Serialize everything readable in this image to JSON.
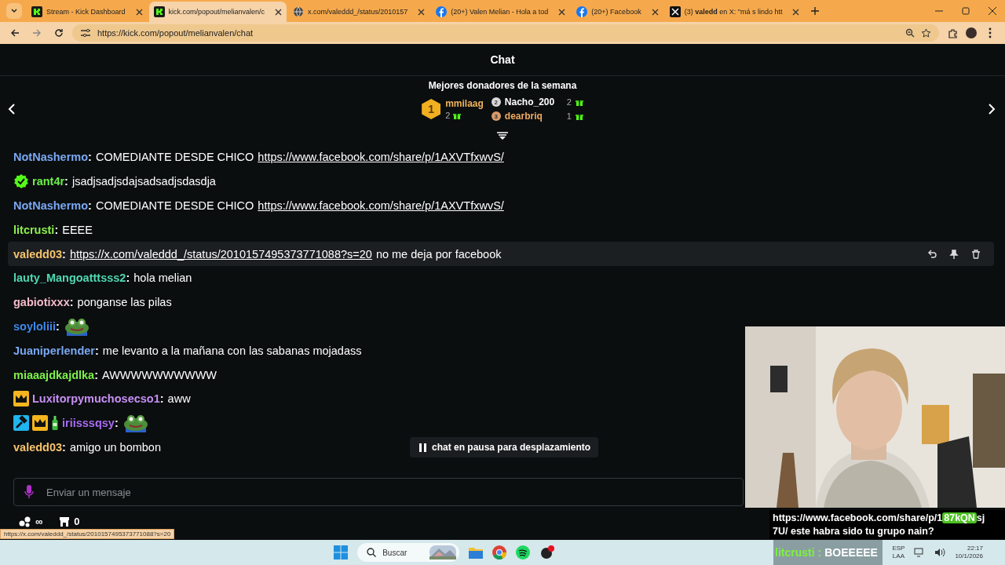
{
  "browser": {
    "tabs": [
      {
        "title": "Stream - Kick Dashboard",
        "selected": false
      },
      {
        "title": "kick.com/popout/melianvalen/c",
        "selected": true
      },
      {
        "title": "x.com/valeddd_/status/2010157",
        "selected": false
      },
      {
        "title": "(20+) Valen Melian - Hola a tod",
        "selected": false
      },
      {
        "title": "(20+) Facebook",
        "selected": false
      },
      {
        "title": "(3) **valedd** en X: \"má s lindo htt",
        "selected": false
      }
    ],
    "url": "https://kick.com/popout/melianvalen/chat"
  },
  "chat": {
    "title": "Chat",
    "donors": {
      "title": "Mejores donadores de la semana",
      "list": [
        {
          "rank": "1",
          "name": "mmilaag",
          "count": "2",
          "color": "#f0b35c"
        },
        {
          "rank": "2",
          "name": "Nacho_200",
          "count": "2",
          "color": "#ffffff"
        },
        {
          "rank": "3",
          "name": "dearbriq",
          "count": "1",
          "color": "#f0a860"
        }
      ]
    },
    "messages": [
      {
        "user": "NotNashermo",
        "sep": ":",
        "color": "#79a8f2",
        "highlighted": false,
        "parts": [
          {
            "kind": "text",
            "text": "COMEDIANTE DESDE CHICO"
          },
          {
            "kind": "link",
            "text": "https://www.facebook.com/share/p/1AXVTfxwvS/"
          }
        ]
      },
      {
        "user": "rant4r",
        "sep": ":",
        "color": "#6cf04a",
        "badges": [
          {
            "kind": "verified"
          }
        ],
        "highlighted": false,
        "parts": [
          {
            "kind": "text",
            "text": "jsadjsadjsdajsadsadjsdasdja"
          }
        ]
      },
      {
        "user": "NotNashermo",
        "sep": ":",
        "color": "#79a8f2",
        "highlighted": false,
        "parts": [
          {
            "kind": "text",
            "text": "COMEDIANTE DESDE CHICO"
          },
          {
            "kind": "link",
            "text": "https://www.facebook.com/share/p/1AXVTfxwvS/"
          }
        ]
      },
      {
        "user": "litcrusti",
        "sep": ":",
        "color": "#8cf04c",
        "highlighted": false,
        "parts": [
          {
            "kind": "text",
            "text": "EEEE"
          }
        ]
      },
      {
        "user": "valedd03",
        "sep": ":",
        "color": "#f6c36a",
        "highlighted": true,
        "parts": [
          {
            "kind": "link",
            "text": "https://x.com/valeddd_/status/2010157495373771088?s=20"
          },
          {
            "kind": "text",
            "text": "no me deja por facebook"
          }
        ]
      },
      {
        "user": "lauty_Mangoatttsss2",
        "sep": ":",
        "color": "#4fd8b2",
        "highlighted": false,
        "parts": [
          {
            "kind": "text",
            "text": "hola melian"
          }
        ]
      },
      {
        "user": "gabiotixxx",
        "sep": ":",
        "color": "#f4bccb",
        "highlighted": false,
        "parts": [
          {
            "kind": "text",
            "text": "ponganse las pilas"
          }
        ]
      },
      {
        "user": "soyloliii",
        "sep": ":",
        "color": "#3f88ea",
        "highlighted": false,
        "parts": [
          {
            "kind": "emote"
          }
        ]
      },
      {
        "user": "Juaniperlender",
        "sep": ":",
        "color": "#79a8f2",
        "highlighted": false,
        "parts": [
          {
            "kind": "text",
            "text": "me levanto a la mañana con las sabanas mojadass"
          }
        ]
      },
      {
        "user": "miaaajdkajdlka",
        "sep": ":",
        "color": "#7cf04a",
        "highlighted": false,
        "parts": [
          {
            "kind": "text",
            "text": "AWWWWWWWWWW"
          }
        ]
      },
      {
        "user": "Luxitorpymuchosecso1",
        "sep": ":",
        "color": "#c890f6",
        "badges": [
          {
            "kind": "crown"
          }
        ],
        "highlighted": false,
        "parts": [
          {
            "kind": "text",
            "text": "aww"
          }
        ]
      },
      {
        "user": "iriisssqsy",
        "sep": ":",
        "color": "#a96cf2",
        "badges": [
          {
            "kind": "moderator"
          },
          {
            "kind": "crown"
          },
          {
            "kind": "bottle"
          }
        ],
        "highlighted": false,
        "parts": [
          {
            "kind": "emote"
          }
        ]
      },
      {
        "user": "valedd03",
        "sep": ":",
        "color": "#f6c36a",
        "highlighted": false,
        "parts": [
          {
            "kind": "text",
            "text": "amigo un bombon"
          }
        ]
      }
    ],
    "paused": "chat en pausa para desplazamiento",
    "input": {
      "placeholder": "Enviar un mensaje"
    },
    "footer": {
      "points": "∞",
      "store": "0"
    }
  },
  "status_link": "https://x.com/valeddd_/status/2010157495373771088?s=20",
  "overlay": {
    "lines": [
      [
        {
          "text": "https://www.facebook.com/share/p/1",
          "highlighted": false
        },
        {
          "text": "87kQN",
          "highlighted": true
        },
        {
          "text": "sj",
          "highlighted": false
        }
      ],
      [
        {
          "text": "7U/ este habra sido tu grupo nain?",
          "highlighted": false
        }
      ]
    ],
    "event": {
      "user": "litcrusti",
      "sep": ":",
      "text": "BOEEEEE"
    }
  },
  "taskbar": {
    "search": "Buscar",
    "lang": "ESP",
    "layout": "LAA",
    "time": "22:17",
    "date": "10/1/2026"
  }
}
